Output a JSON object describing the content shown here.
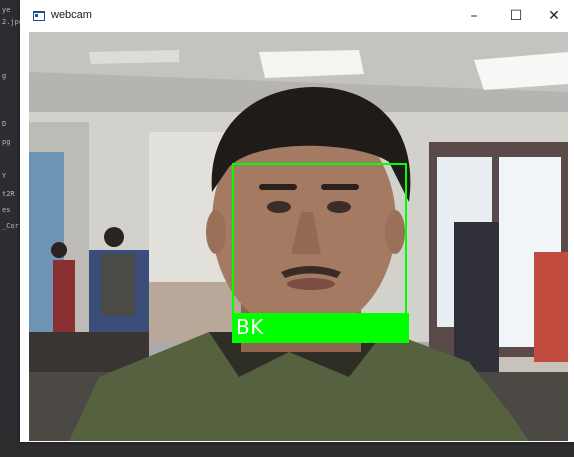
{
  "background_window": {
    "text_lines": [
      "ye",
      "2.jpg",
      "g",
      "D",
      "pg",
      "Y",
      "t2R",
      "es",
      "_Cor"
    ]
  },
  "window": {
    "title": "webcam",
    "icon": "app-window-icon",
    "controls": {
      "minimize": "–",
      "maximize": "☐",
      "close": "✕"
    }
  },
  "detection": {
    "label": "BK",
    "box_color": "#00ff00",
    "label_color": "#ffffff"
  }
}
